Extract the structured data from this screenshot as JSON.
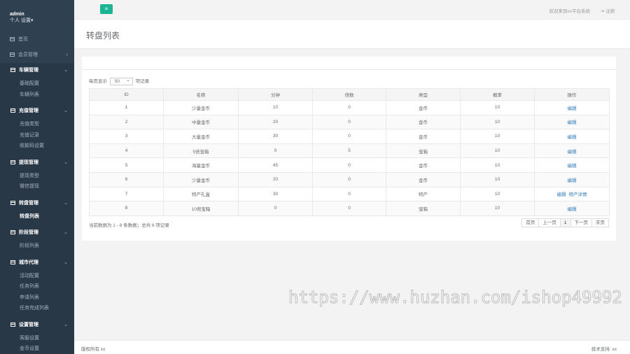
{
  "sidebar": {
    "user": "admin",
    "settings_label": "个人 设置▾",
    "home": "首页",
    "member": "会员管理",
    "groups": [
      {
        "title": "车辆管理",
        "items": [
          "基础配置",
          "车辆列表"
        ]
      },
      {
        "title": "充值管理",
        "items": [
          "充值类型",
          "充值记录",
          "收款码设置"
        ]
      },
      {
        "title": "提现管理",
        "items": [
          "提现类型",
          "微信提现"
        ]
      },
      {
        "title": "转盘管理",
        "items": [
          "转盘列表"
        ]
      },
      {
        "title": "阶段管理",
        "items": [
          "阶段列表"
        ]
      },
      {
        "title": "城市代理",
        "items": [
          "活动配置",
          "任务列表",
          "申请列表",
          "任务完成列表"
        ]
      },
      {
        "title": "设置管理",
        "items": [
          "客服设置",
          "金币设置"
        ]
      }
    ]
  },
  "topbar": {
    "menu_icon": "≡",
    "welcome": "欢迎来到xx平台系统",
    "logout": "注销"
  },
  "page": {
    "title": "转盘列表"
  },
  "table": {
    "length_prefix": "每页显示",
    "length_value": "50",
    "length_suffix": "项记录",
    "columns": [
      "ID",
      "名称",
      "分钟",
      "倍数",
      "类型",
      "概率",
      "操作"
    ],
    "rows": [
      [
        "1",
        "少量金币",
        "10",
        "0",
        "金币",
        "10",
        "编辑"
      ],
      [
        "2",
        "中量金币",
        "20",
        "0",
        "金币",
        "10",
        "编辑"
      ],
      [
        "3",
        "大量金币",
        "30",
        "0",
        "金币",
        "10",
        "编辑"
      ],
      [
        "4",
        "5倍宝箱",
        "0",
        "5",
        "宝箱",
        "10",
        "编辑"
      ],
      [
        "5",
        "海量金币",
        "45",
        "0",
        "金币",
        "10",
        "编辑"
      ],
      [
        "6",
        "少量金币",
        "20",
        "0",
        "金币",
        "10",
        "编辑"
      ],
      [
        "7",
        "特产礼盒",
        "30",
        "0",
        "特产",
        "10",
        "编辑|特产详情"
      ],
      [
        "8",
        "10倍宝箱",
        "0",
        "0",
        "宝箱",
        "10",
        "编辑"
      ]
    ],
    "info": "当前数据为 1 - 8 条数据；总共 8 项记录",
    "pager": [
      "首页",
      "上一页",
      "1",
      "下一页",
      "末页"
    ],
    "current_page": "1"
  },
  "watermark": "https://www.huzhan.com/ishop49992",
  "footer": {
    "copyright": "版权所有 xx",
    "support": "技术支持: xx"
  },
  "colors": {
    "sidebar": "#2f4050",
    "accent": "#1ab394",
    "link": "#337ab7"
  }
}
